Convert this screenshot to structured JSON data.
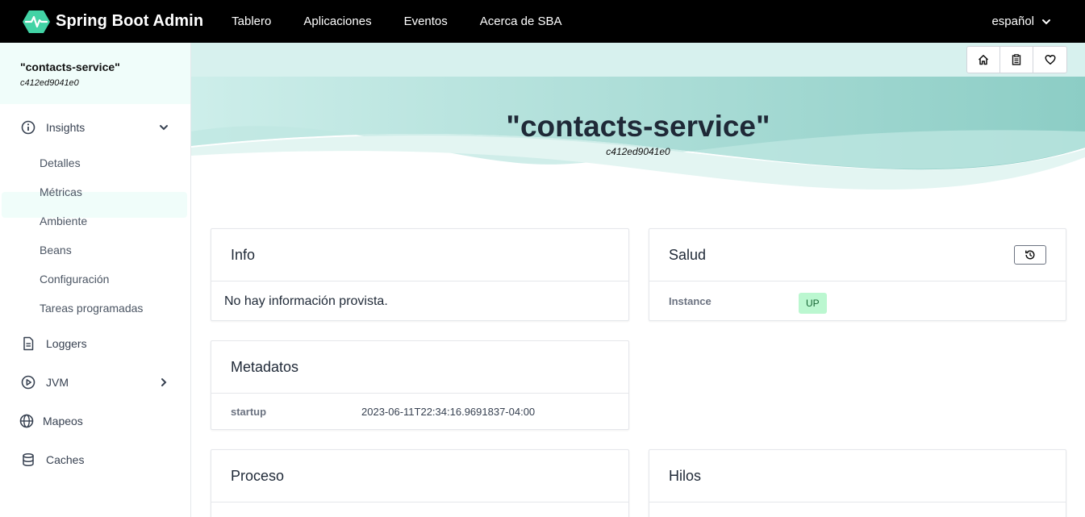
{
  "brand": {
    "title": "Spring Boot Admin",
    "logo_icon": "heartbeat-hexagon-icon",
    "accent": "#42d3a5"
  },
  "nav": {
    "links": [
      "Tablero",
      "Aplicaciones",
      "Eventos",
      "Acerca de SBA"
    ],
    "language": "español"
  },
  "sidebar": {
    "app_name": "\"contacts-service\"",
    "instance_id": "c412ed9041e0",
    "groups": {
      "insights": {
        "label": "Insights",
        "icon": "info-circle-icon",
        "expanded": true
      },
      "loggers": {
        "label": "Loggers",
        "icon": "document-icon"
      },
      "jvm": {
        "label": "JVM",
        "icon": "play-circle-icon",
        "expanded": false
      },
      "mapeos": {
        "label": "Mapeos",
        "icon": "globe-icon"
      },
      "caches": {
        "label": "Caches",
        "icon": "database-icon"
      }
    },
    "insights_items": [
      "Detalles",
      "Métricas",
      "Ambiente",
      "Beans",
      "Configuración",
      "Tareas programadas"
    ],
    "active_item": "Detalles"
  },
  "hero": {
    "title": "\"contacts-service\"",
    "subtitle": "c412ed9041e0"
  },
  "toolbar": {
    "icons": [
      "home-icon",
      "clipboard-icon",
      "heart-icon"
    ]
  },
  "cards": {
    "info": {
      "title": "Info",
      "message": "No hay información provista."
    },
    "salud": {
      "title": "Salud",
      "history_icon": "history-icon",
      "key": "Instance",
      "status": "UP",
      "status_color": "#bbf7d0"
    },
    "metadatos": {
      "title": "Metadatos",
      "key": "startup",
      "value": "2023-06-11T22:34:16.9691837-04:00"
    },
    "proceso": {
      "title": "Proceso"
    },
    "hilos": {
      "title": "Hilos"
    }
  }
}
